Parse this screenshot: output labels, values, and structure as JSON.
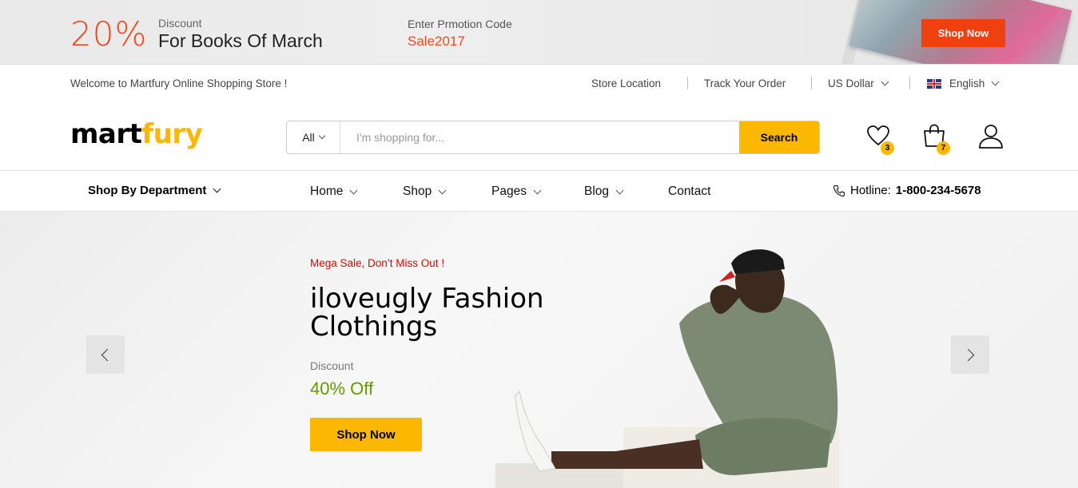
{
  "promo": {
    "percent": "20%",
    "discount_label": "Discount",
    "discount_title": "For Books Of March",
    "code_label": "Enter Prmotion Code",
    "code_value": "Sale2017",
    "shop_now": "Shop Now",
    "accent": "#f0491f"
  },
  "toplinks": {
    "welcome": "Welcome to Martfury Online Shopping Store !",
    "store_location": "Store Location",
    "track_order": "Track Your Order",
    "currency": "US Dollar",
    "language": "English"
  },
  "header": {
    "logo_part1": "mart",
    "logo_part2": "fury",
    "search_category": "All",
    "search_placeholder": "I'm shopping for...",
    "search_button": "Search",
    "wishlist_count": "3",
    "cart_count": "7",
    "brand_color": "#fcb800"
  },
  "nav": {
    "department": "Shop By Department",
    "items": [
      "Home",
      "Shop",
      "Pages",
      "Blog",
      "Contact"
    ],
    "hotline_label": "Hotline:",
    "hotline_number": "1-800-234-5678"
  },
  "hero": {
    "subtitle": "Mega Sale, Don’t Miss Out !",
    "title": "iloveugly Fashion Clothings",
    "discount_label": "Discount",
    "discount_value": "40% Off",
    "cta": "Shop Now"
  }
}
